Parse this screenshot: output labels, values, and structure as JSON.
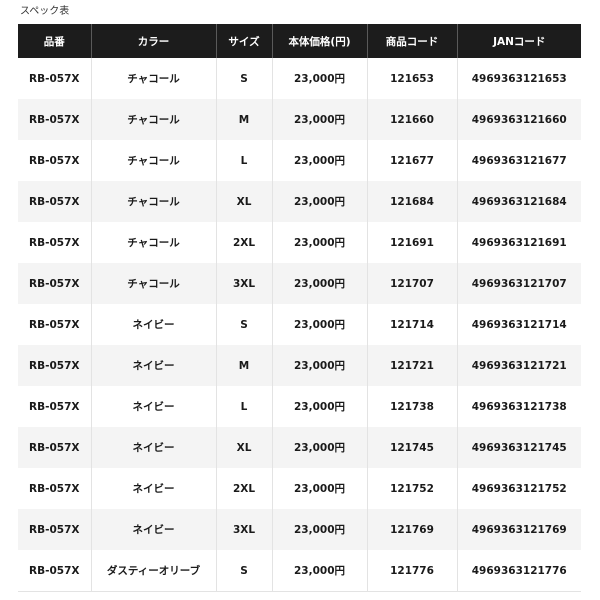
{
  "caption": "スペック表",
  "table": {
    "headers": [
      "品番",
      "カラー",
      "サイズ",
      "本体価格(円)",
      "商品コード",
      "JANコード"
    ],
    "rows": [
      [
        "RB-057X",
        "チャコール",
        "S",
        "23,000円",
        "121653",
        "4969363121653"
      ],
      [
        "RB-057X",
        "チャコール",
        "M",
        "23,000円",
        "121660",
        "4969363121660"
      ],
      [
        "RB-057X",
        "チャコール",
        "L",
        "23,000円",
        "121677",
        "4969363121677"
      ],
      [
        "RB-057X",
        "チャコール",
        "XL",
        "23,000円",
        "121684",
        "4969363121684"
      ],
      [
        "RB-057X",
        "チャコール",
        "2XL",
        "23,000円",
        "121691",
        "4969363121691"
      ],
      [
        "RB-057X",
        "チャコール",
        "3XL",
        "23,000円",
        "121707",
        "4969363121707"
      ],
      [
        "RB-057X",
        "ネイビー",
        "S",
        "23,000円",
        "121714",
        "4969363121714"
      ],
      [
        "RB-057X",
        "ネイビー",
        "M",
        "23,000円",
        "121721",
        "4969363121721"
      ],
      [
        "RB-057X",
        "ネイビー",
        "L",
        "23,000円",
        "121738",
        "4969363121738"
      ],
      [
        "RB-057X",
        "ネイビー",
        "XL",
        "23,000円",
        "121745",
        "4969363121745"
      ],
      [
        "RB-057X",
        "ネイビー",
        "2XL",
        "23,000円",
        "121752",
        "4969363121752"
      ],
      [
        "RB-057X",
        "ネイビー",
        "3XL",
        "23,000円",
        "121769",
        "4969363121769"
      ],
      [
        "RB-057X",
        "ダスティーオリーブ",
        "S",
        "23,000円",
        "121776",
        "4969363121776"
      ]
    ]
  }
}
